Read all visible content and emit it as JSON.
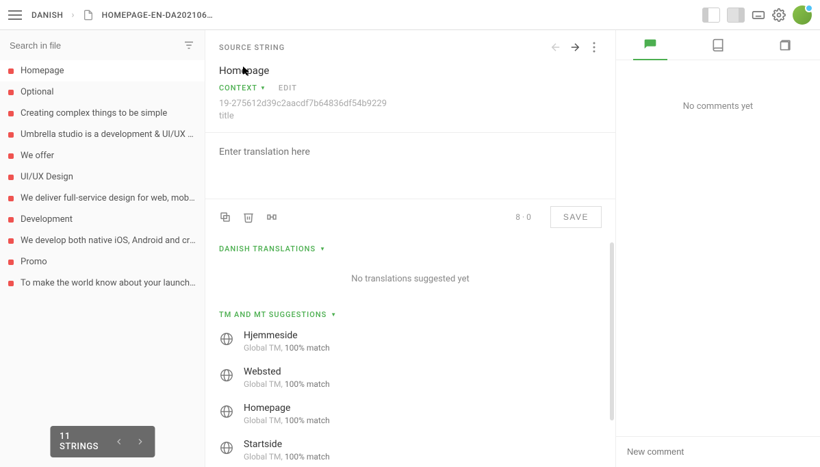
{
  "breadcrumb": {
    "language": "DANISH",
    "filename": "HOMEPAGE-EN-DA202106…"
  },
  "search": {
    "placeholder": "Search in file"
  },
  "strings": [
    {
      "text": "Homepage",
      "selected": true
    },
    {
      "text": "Optional",
      "selected": false
    },
    {
      "text": "Creating complex things to be simple",
      "selected": false
    },
    {
      "text": "Umbrella studio is a development & UI/UX design …",
      "selected": false
    },
    {
      "text": "We offer",
      "selected": false
    },
    {
      "text": "UI/UX Design",
      "selected": false
    },
    {
      "text": "We deliver full-service design for web, mobile, and …",
      "selected": false
    },
    {
      "text": "Development",
      "selected": false
    },
    {
      "text": "We develop both native iOS, Android and cross-pla…",
      "selected": false
    },
    {
      "text": "Promo",
      "selected": false
    },
    {
      "text": "To make the world know about your launching bus…",
      "selected": false
    }
  ],
  "strings_footer": {
    "count_label": "11 STRINGS"
  },
  "editor": {
    "source_label": "SOURCE STRING",
    "source_text": "Homepage",
    "context_label": "CONTEXT",
    "edit_label": "EDIT",
    "context_hash": "19-275612d39c2aacdf7b64836df54b9229",
    "context_key": "title",
    "translation_placeholder": "Enter translation here",
    "char_count": "8 · 0",
    "save_label": "SAVE",
    "translations_heading": "DANISH TRANSLATIONS",
    "no_translations": "No translations suggested yet",
    "tm_heading": "TM AND MT SUGGESTIONS",
    "suggestions": [
      {
        "text": "Hjemmeside",
        "source": "Global TM,",
        "match": "100% match"
      },
      {
        "text": "Websted",
        "source": "Global TM,",
        "match": "100% match"
      },
      {
        "text": "Homepage",
        "source": "Global TM,",
        "match": "100% match"
      },
      {
        "text": "Startside",
        "source": "Global TM,",
        "match": "100% match"
      }
    ]
  },
  "rightpanel": {
    "no_comments": "No comments yet",
    "comment_placeholder": "New comment"
  }
}
